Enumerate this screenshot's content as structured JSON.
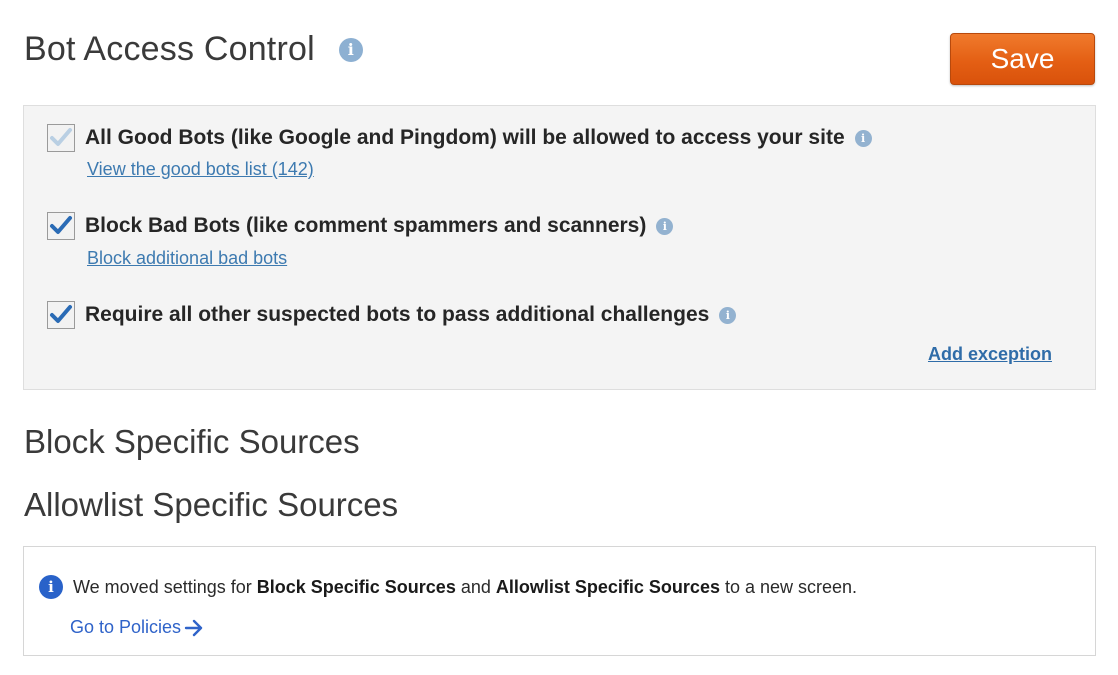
{
  "header": {
    "title": "Bot Access Control",
    "save_label": "Save"
  },
  "bot_options": [
    {
      "label": "All Good Bots (like Google and Pingdom) will be allowed to access your site",
      "checked": true,
      "disabled": true,
      "link": "View the good bots list (142)"
    },
    {
      "label": "Block Bad Bots (like comment spammers and scanners)",
      "checked": true,
      "disabled": false,
      "link": "Block additional bad bots"
    },
    {
      "label": "Require all other suspected bots to pass additional challenges",
      "checked": true,
      "disabled": false
    }
  ],
  "add_exception_label": "Add exception",
  "sections": {
    "block_specific": "Block Specific Sources",
    "allowlist_specific": "Allowlist Specific Sources"
  },
  "notice": {
    "text_1": "We moved settings for ",
    "bold_1": "Block Specific Sources",
    "text_2": " and ",
    "bold_2": "Allowlist Specific Sources",
    "text_3": " to a new screen.",
    "link": "Go to Policies"
  },
  "icons": {
    "info": "info-icon",
    "check": "checkmark-icon",
    "arrow": "arrow-right-icon"
  },
  "colors": {
    "save_button": "#e45f14",
    "link": "#3d7ab0",
    "info_blue": "#2962c9",
    "panel_bg": "#f4f4f4"
  }
}
